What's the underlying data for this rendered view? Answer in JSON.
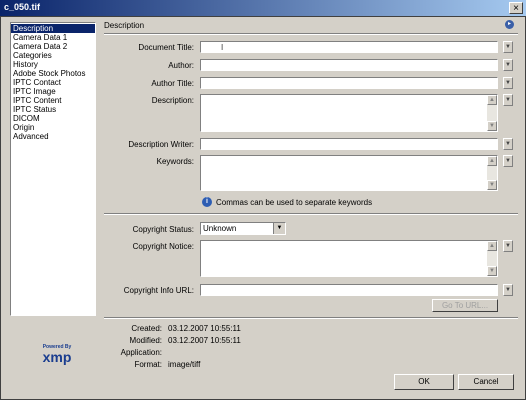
{
  "window": {
    "title": "c_050.tif",
    "close": "×"
  },
  "sidebar": {
    "items": [
      {
        "label": "Description",
        "selected": true
      },
      {
        "label": "Camera Data 1"
      },
      {
        "label": "Camera Data 2"
      },
      {
        "label": "Categories"
      },
      {
        "label": "History"
      },
      {
        "label": "Adobe Stock Photos"
      },
      {
        "label": "IPTC Contact"
      },
      {
        "label": "IPTC Image"
      },
      {
        "label": "IPTC Content"
      },
      {
        "label": "IPTC Status"
      },
      {
        "label": "DICOM"
      },
      {
        "label": "Origin"
      },
      {
        "label": "Advanced"
      }
    ]
  },
  "logo": {
    "powered_by": "Powered By",
    "name": "xmp"
  },
  "section": {
    "title": "Description"
  },
  "fields": {
    "document_title": {
      "label": "Document Title:",
      "value": ""
    },
    "author": {
      "label": "Author:",
      "value": ""
    },
    "author_title": {
      "label": "Author Title:",
      "value": ""
    },
    "description": {
      "label": "Description:",
      "value": ""
    },
    "description_writer": {
      "label": "Description Writer:",
      "value": ""
    },
    "keywords": {
      "label": "Keywords:",
      "value": ""
    },
    "keywords_hint": "Commas can be used to separate keywords",
    "copyright_status": {
      "label": "Copyright Status:",
      "value": "Unknown"
    },
    "copyright_notice": {
      "label": "Copyright Notice:",
      "value": ""
    },
    "copyright_url": {
      "label": "Copyright Info URL:",
      "value": ""
    },
    "goto_url": "Go To URL..."
  },
  "metadata": {
    "created": {
      "label": "Created:",
      "value": "03.12.2007 10:55:11"
    },
    "modified": {
      "label": "Modified:",
      "value": "03.12.2007 10:55:11"
    },
    "application": {
      "label": "Application:",
      "value": ""
    },
    "format": {
      "label": "Format:",
      "value": "image/tiff"
    }
  },
  "buttons": {
    "ok": "OK",
    "cancel": "Cancel"
  },
  "colors": {
    "titlebar": "#0a246a",
    "selection": "#0a246a",
    "face": "#d4d0c8",
    "logo": "#1a3d8f"
  }
}
